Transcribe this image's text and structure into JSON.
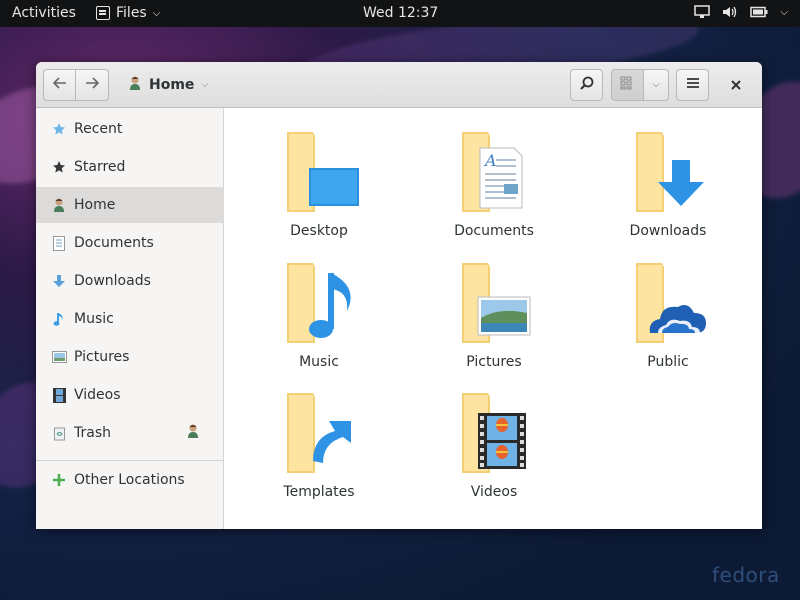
{
  "topbar": {
    "activities": "Activities",
    "app_name": "Files",
    "clock": "Wed 12:37"
  },
  "window": {
    "path_label": "Home"
  },
  "sidebar": {
    "items": [
      {
        "label": "Recent",
        "icon": "recent-star-icon"
      },
      {
        "label": "Starred",
        "icon": "star-icon"
      },
      {
        "label": "Home",
        "icon": "home-user-icon"
      },
      {
        "label": "Documents",
        "icon": "document-icon"
      },
      {
        "label": "Downloads",
        "icon": "download-arrow-icon"
      },
      {
        "label": "Music",
        "icon": "music-note-icon"
      },
      {
        "label": "Pictures",
        "icon": "picture-icon"
      },
      {
        "label": "Videos",
        "icon": "film-icon"
      },
      {
        "label": "Trash",
        "icon": "trash-icon"
      },
      {
        "label": "Other Locations",
        "icon": "plus-icon"
      }
    ]
  },
  "files": [
    {
      "name": "Desktop"
    },
    {
      "name": "Documents"
    },
    {
      "name": "Downloads"
    },
    {
      "name": "Music"
    },
    {
      "name": "Pictures"
    },
    {
      "name": "Public"
    },
    {
      "name": "Templates"
    },
    {
      "name": "Videos"
    }
  ],
  "wallpaper_brand": "fedora",
  "colors": {
    "folder": "#f7d983",
    "accent_blue": "#3d9ee6",
    "sidebar_active": "#dddbda"
  }
}
